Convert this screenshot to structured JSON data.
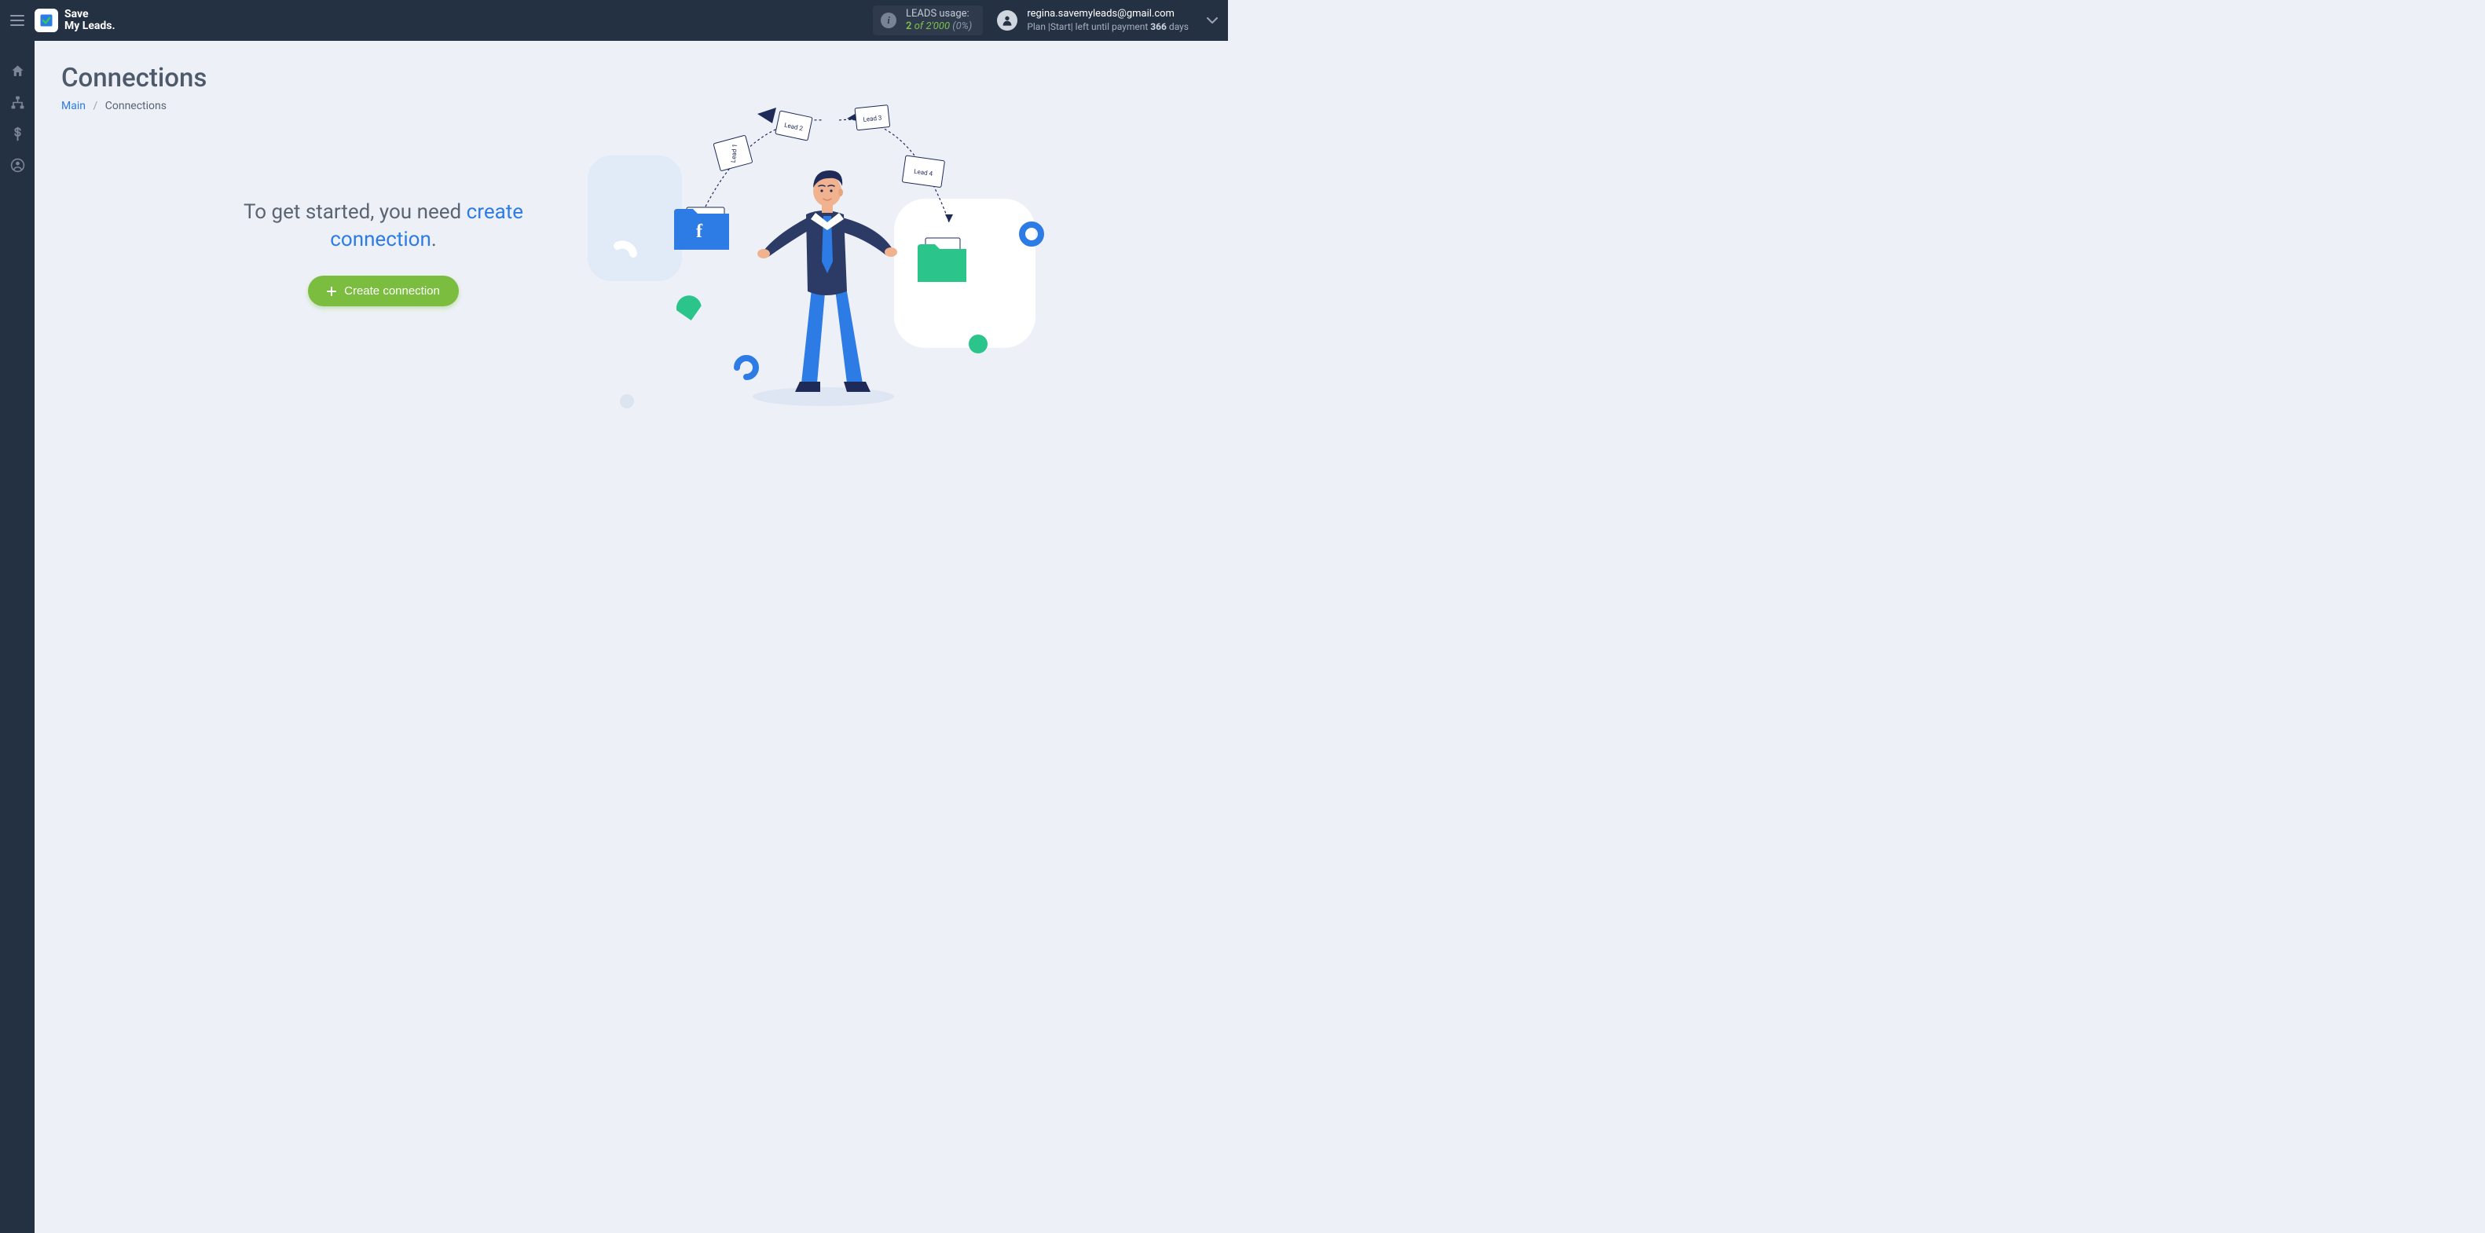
{
  "header": {
    "logo_line1": "Save",
    "logo_line2": "My Leads.",
    "leads": {
      "label": "LEADS usage:",
      "used": "2",
      "of_word": "of",
      "total": "2'000",
      "pct": "(0%)"
    },
    "user": {
      "email": "regina.savemyleads@gmail.com",
      "plan_prefix": "Plan |",
      "plan_name": "Start",
      "plan_mid": "| left until payment",
      "plan_days_number": "366",
      "plan_days_word": "days"
    }
  },
  "page": {
    "title": "Connections",
    "breadcrumb_main": "Main",
    "breadcrumb_current": "Connections"
  },
  "empty": {
    "headline_prefix": "To get started, you need ",
    "headline_link": "create connection",
    "headline_suffix": ".",
    "button_label": "Create connection"
  },
  "illustration": {
    "lead_labels": [
      "Lead 1",
      "Lead 2",
      "Lead 3",
      "Lead 4"
    ],
    "fb_letter": "f"
  }
}
